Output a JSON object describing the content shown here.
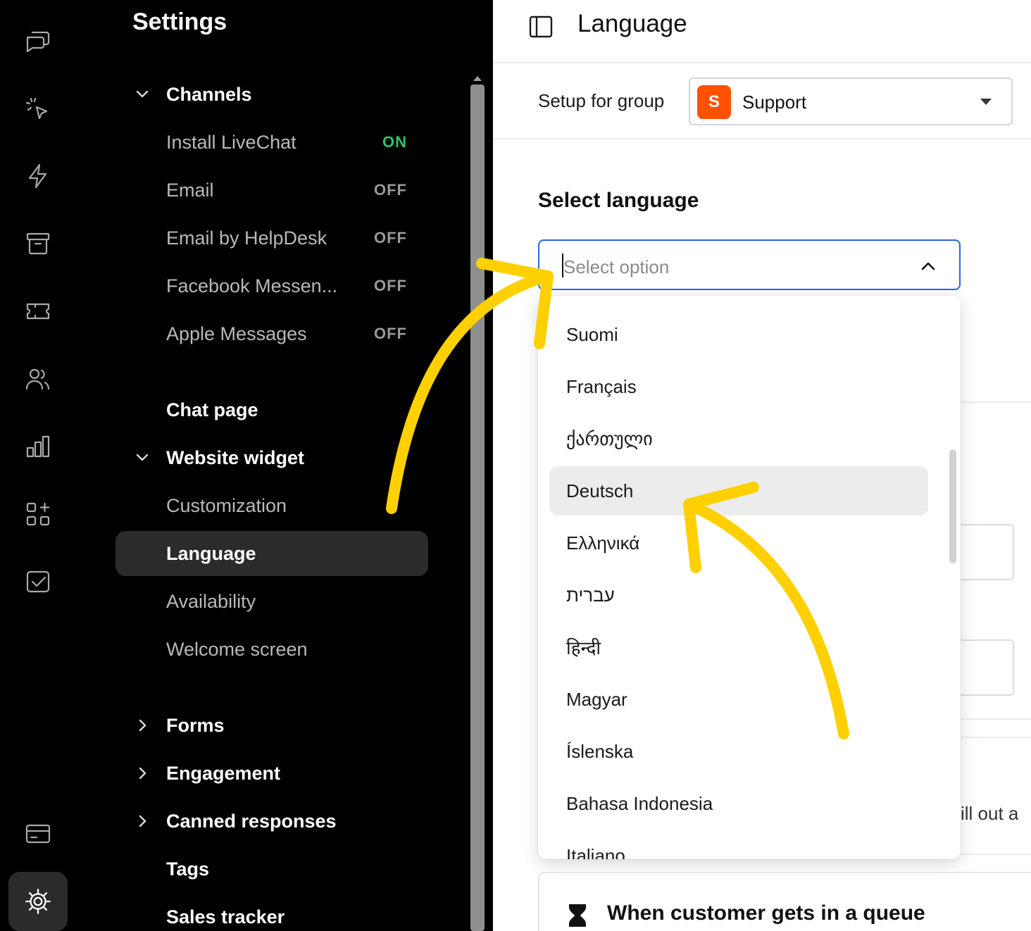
{
  "rail": {
    "icons": [
      "chats-icon",
      "ai-sparkle-icon",
      "automation-bolt-icon",
      "archive-icon",
      "ticket-icon",
      "team-icon",
      "reports-icon",
      "apps-icon",
      "checklist-icon",
      "billing-icon",
      "settings-gear-icon"
    ]
  },
  "settings": {
    "title": "Settings",
    "channels": {
      "label": "Channels",
      "items": [
        {
          "label": "Install LiveChat",
          "state": "ON"
        },
        {
          "label": "Email",
          "state": "OFF"
        },
        {
          "label": "Email by HelpDesk",
          "state": "OFF"
        },
        {
          "label": "Facebook Messen...",
          "state": "OFF"
        },
        {
          "label": "Apple Messages",
          "state": "OFF"
        }
      ]
    },
    "chat_page": "Chat page",
    "website_widget": {
      "label": "Website widget",
      "items": [
        "Customization",
        "Language",
        "Availability",
        "Welcome screen"
      ]
    },
    "forms": "Forms",
    "engagement": "Engagement",
    "canned_responses": "Canned responses",
    "tags": "Tags",
    "sales_tracker": "Sales tracker"
  },
  "main": {
    "title": "Language",
    "group": {
      "label": "Setup for group",
      "badge": "S",
      "name": "Support",
      "badge_color": "#ff5100"
    },
    "section_title": "Select language",
    "select_placeholder": "Select option",
    "options": [
      "Suomi",
      "Français",
      "ქართული",
      "Deutsch",
      "Ελληνικά",
      "עברית",
      "हिन्दी",
      "Magyar",
      "Íslenska",
      "Bahasa Indonesia",
      "Italiano"
    ],
    "hovered_option": "Deutsch",
    "bg_partial_text": "ill out a",
    "queue_card": "When customer gets in a queue"
  },
  "colors": {
    "accent_focus": "#2c64e6",
    "annotation_arrow": "#ffd000",
    "on_state": "#2fc46a"
  }
}
